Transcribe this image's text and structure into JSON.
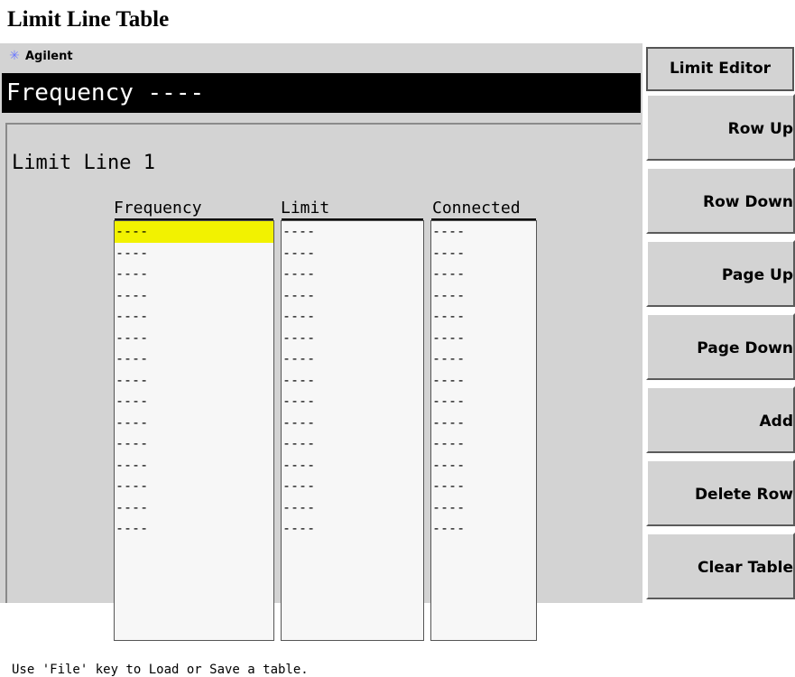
{
  "page_title": "Limit Line Table",
  "brand": "Agilent",
  "measurement_bar": "Frequency ----",
  "limit_line_title": "Limit Line 1",
  "columns": [
    {
      "header": "Frequency",
      "rows": [
        "----",
        "----",
        "----",
        "----",
        "----",
        "----",
        "----",
        "----",
        "----",
        "----",
        "----",
        "----",
        "----",
        "----",
        "----"
      ]
    },
    {
      "header": "Limit",
      "rows": [
        "----",
        "----",
        "----",
        "----",
        "----",
        "----",
        "----",
        "----",
        "----",
        "----",
        "----",
        "----",
        "----",
        "----",
        "----"
      ]
    },
    {
      "header": "Connected",
      "rows": [
        "----",
        "----",
        "----",
        "----",
        "----",
        "----",
        "----",
        "----",
        "----",
        "----",
        "----",
        "----",
        "----",
        "----",
        "----"
      ]
    }
  ],
  "selected_cell": {
    "column": 0,
    "row": 0
  },
  "selection_color": "#f2f200",
  "status_message": "Use 'File' key to Load or Save a table.",
  "menu": {
    "title": "Limit Editor",
    "softkeys": [
      "Row Up",
      "Row Down",
      "Page Up",
      "Page Down",
      "Add",
      "Delete Row",
      "Clear Table"
    ]
  }
}
